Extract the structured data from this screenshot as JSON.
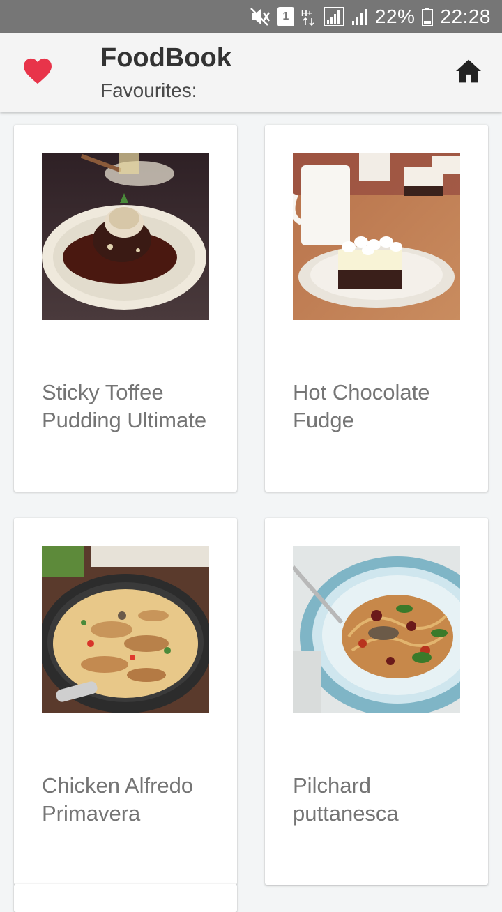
{
  "status_bar": {
    "battery": "22%",
    "time": "22:28",
    "sim_slot": "1",
    "icons": [
      "mute-icon",
      "sim-icon",
      "network-hplus-icon",
      "signal-icon",
      "signal-icon",
      "battery-icon"
    ]
  },
  "app_bar": {
    "title": "FoodBook",
    "subtitle": "Favourites:",
    "left_icon": "heart-icon",
    "right_icon": "home-icon",
    "heart_color": "#e8344a"
  },
  "recipes": [
    {
      "title": "Sticky Toffee Pudding Ultimate"
    },
    {
      "title": "Hot Chocolate Fudge"
    },
    {
      "title": "Chicken Alfredo Primavera"
    },
    {
      "title": "Pilchard puttanesca"
    }
  ]
}
